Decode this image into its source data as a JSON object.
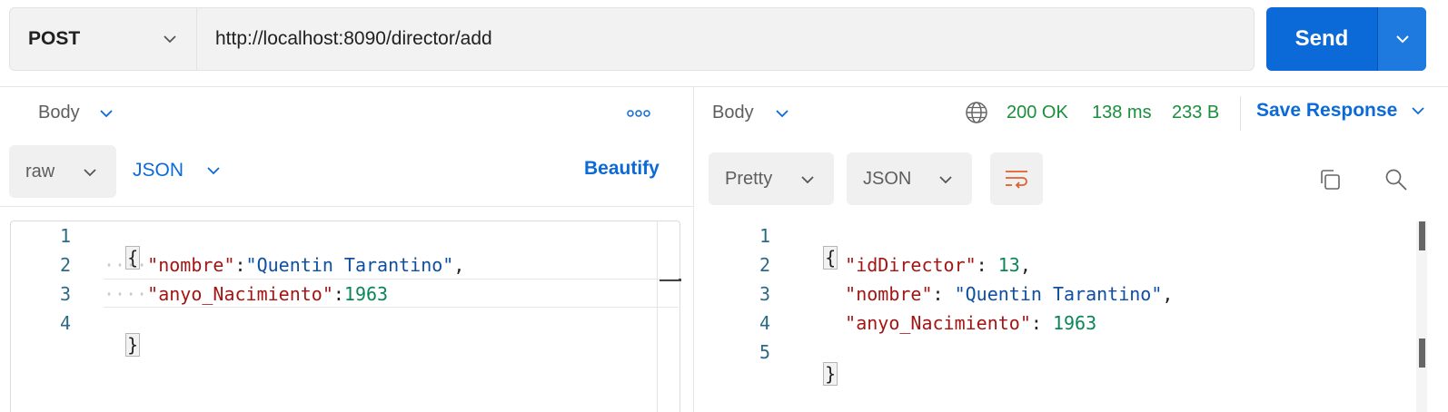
{
  "request": {
    "method": "POST",
    "url": "http://localhost:8090/director/add",
    "send_label": "Send"
  },
  "left_pane": {
    "tab_label": "Body",
    "body_type": "raw",
    "language": "JSON",
    "beautify_label": "Beautify",
    "line_numbers": [
      "1",
      "2",
      "3",
      "4"
    ],
    "code": {
      "open_brace": "{",
      "line2_key": "\"nombre\"",
      "line2_value": "\"Quentin Tarantino\"",
      "line3_key": "\"anyo_Nacimiento\"",
      "line3_value": "1963",
      "close_brace": "}"
    }
  },
  "right_pane": {
    "tab_label": "Body",
    "status": "200 OK",
    "time": "138 ms",
    "size": "233 B",
    "save_response_label": "Save Response",
    "view_mode": "Pretty",
    "language": "JSON",
    "line_numbers": [
      "1",
      "2",
      "3",
      "4",
      "5"
    ],
    "code": {
      "open_brace": "{",
      "line2_key": "\"idDirector\"",
      "line2_value": "13",
      "line3_key": "\"nombre\"",
      "line3_value": "\"Quentin Tarantino\"",
      "line4_key": "\"anyo_Nacimiento\"",
      "line4_value": "1963",
      "close_brace": "}"
    }
  },
  "colors": {
    "accent": "#0b6ad8",
    "status_ok": "#1a8f3c",
    "json_key": "#a31515",
    "json_string": "#0f4fa0",
    "json_number": "#098658",
    "wrap_icon": "#e0602c"
  }
}
